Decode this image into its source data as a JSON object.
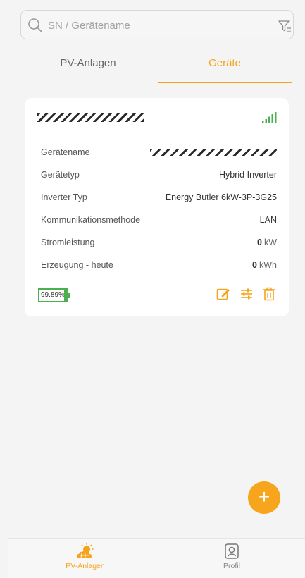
{
  "search": {
    "placeholder": "SN / Gerätename"
  },
  "tabs": [
    {
      "label": "PV-Anlagen",
      "active": false
    },
    {
      "label": "Geräte",
      "active": true
    }
  ],
  "device_card": {
    "signal_icon": "signal-bars-icon",
    "rows": [
      {
        "label": "Gerätename",
        "value": ""
      },
      {
        "label": "Gerätetyp",
        "value": "Hybrid Inverter"
      },
      {
        "label": "Inverter Typ",
        "value": "Energy Butler 6kW-3P-3G25"
      },
      {
        "label": "Kommunikationsmethode",
        "value": "LAN"
      },
      {
        "label": "Stromleistung",
        "value": "0",
        "unit": "kW"
      },
      {
        "label": "Erzeugung - heute",
        "value": "0",
        "unit": "kWh"
      }
    ],
    "battery_soc": "99.89%",
    "actions": [
      "edit-icon",
      "settings-sliders-icon",
      "trash-icon"
    ]
  },
  "fab_label": "+",
  "bottom_nav": [
    {
      "label": "PV-Anlagen",
      "icon": "sun-cloud-icon",
      "active": true
    },
    {
      "label": "Profil",
      "icon": "profile-icon",
      "active": false
    }
  ],
  "colors": {
    "accent": "#f5a31a",
    "battery": "#4caf50"
  }
}
